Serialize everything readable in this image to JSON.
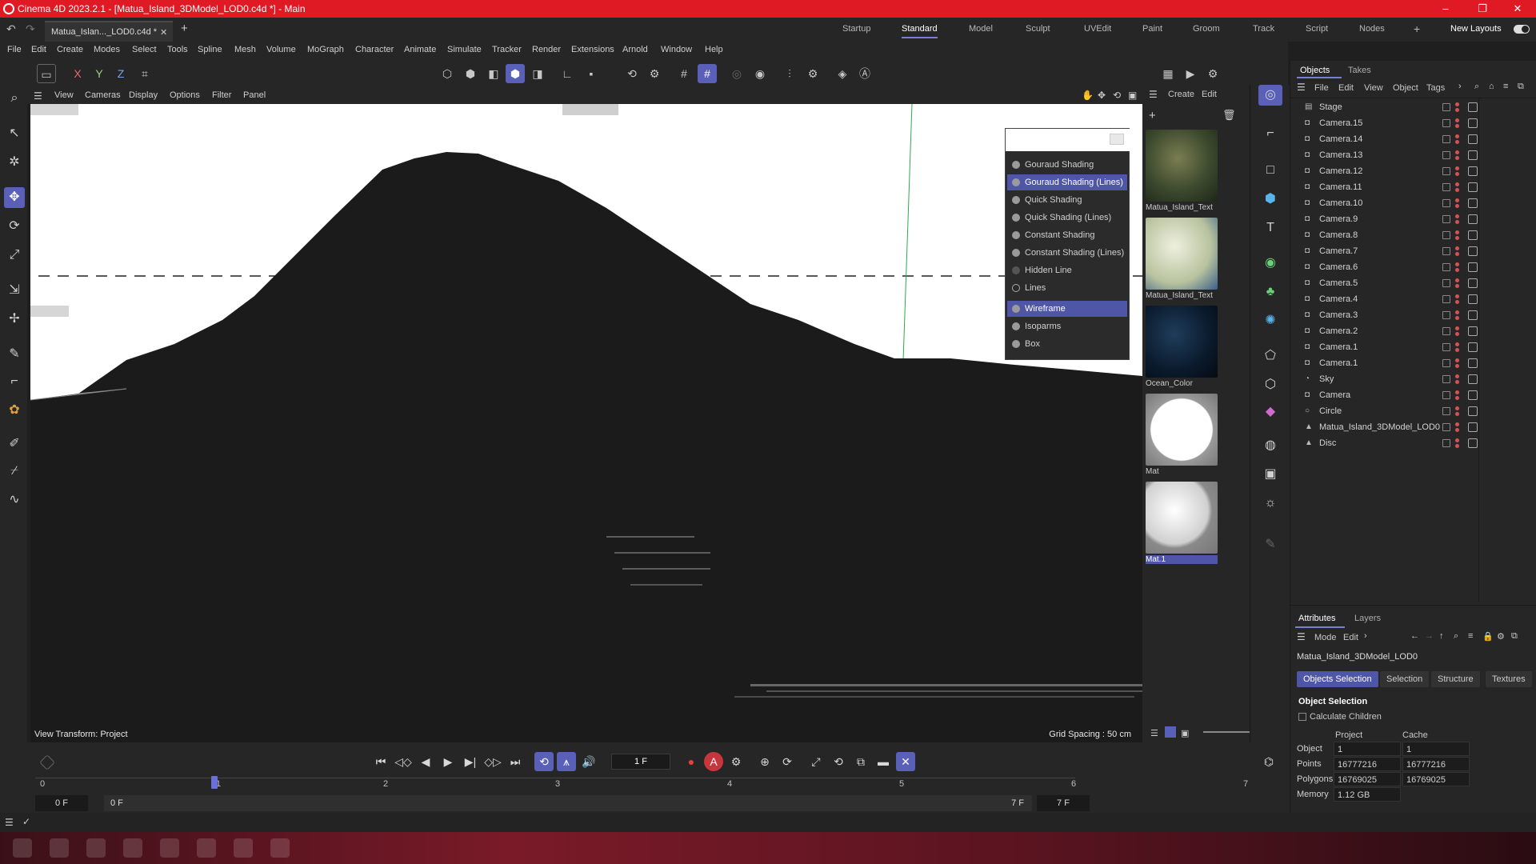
{
  "window": {
    "title": "Cinema 4D 2023.2.1 - [Matua_Island_3DModel_LOD0.c4d *] - Main",
    "minimize": "–",
    "maximize": "❐",
    "close": "✕"
  },
  "doc_tab": {
    "label": "Matua_Islan..._LOD0.c4d *",
    "close": "✕",
    "add": "+"
  },
  "layouts": [
    "Startup",
    "Standard",
    "Model",
    "Sculpt",
    "UVEdit",
    "Paint",
    "Groom",
    "Track",
    "Script",
    "Nodes"
  ],
  "layouts_active": "Standard",
  "layouts_add": "+",
  "new_layouts": "New Layouts",
  "menu": [
    "File",
    "Edit",
    "Create",
    "Modes",
    "Select",
    "Tools",
    "Spline",
    "Mesh",
    "Volume",
    "MoGraph",
    "Character",
    "Animate",
    "Simulate",
    "Tracker",
    "Render",
    "Extensions",
    "Arnold",
    "Window",
    "Help"
  ],
  "axis_buttons": {
    "x": "X",
    "y": "Y",
    "z": "Z"
  },
  "viewport_menu": [
    "View",
    "Cameras",
    "Display",
    "Options",
    "Filter",
    "Panel"
  ],
  "viewport": {
    "view_transform": "View Transform: Project",
    "grid_spacing": "Grid Spacing : 50 cm"
  },
  "display_menu": {
    "items": [
      "Gouraud Shading",
      "Gouraud Shading (Lines)",
      "Quick Shading",
      "Quick Shading (Lines)",
      "Constant Shading",
      "Constant Shading (Lines)",
      "Hidden Line",
      "Lines",
      "Wireframe",
      "Isoparms",
      "Box"
    ],
    "selected": [
      "Gouraud Shading (Lines)",
      "Wireframe"
    ]
  },
  "material_panel": {
    "menu": [
      "Create",
      "Edit"
    ],
    "materials": [
      {
        "name": "Matua_Island_Text",
        "color": "#4a5a3a"
      },
      {
        "name": "Matua_Island_Text",
        "color": "#c9d4b8"
      },
      {
        "name": "Ocean_Color",
        "color": "#0e2236"
      },
      {
        "name": "Mat",
        "color": "#ffffff"
      },
      {
        "name": "Mat.1",
        "color": "#e6e6e6"
      }
    ],
    "selected": "Mat.1"
  },
  "objects_panel": {
    "tabs": [
      "Objects",
      "Takes"
    ],
    "menu": [
      "File",
      "Edit",
      "View",
      "Object",
      "Tags"
    ],
    "items": [
      {
        "name": "Stage",
        "icon": "stage-icon"
      },
      {
        "name": "Camera.15",
        "icon": "camera-icon"
      },
      {
        "name": "Camera.14",
        "icon": "camera-icon"
      },
      {
        "name": "Camera.13",
        "icon": "camera-icon"
      },
      {
        "name": "Camera.12",
        "icon": "camera-icon"
      },
      {
        "name": "Camera.11",
        "icon": "camera-icon"
      },
      {
        "name": "Camera.10",
        "icon": "camera-icon"
      },
      {
        "name": "Camera.9",
        "icon": "camera-icon"
      },
      {
        "name": "Camera.8",
        "icon": "camera-icon"
      },
      {
        "name": "Camera.7",
        "icon": "camera-icon"
      },
      {
        "name": "Camera.6",
        "icon": "camera-icon"
      },
      {
        "name": "Camera.5",
        "icon": "camera-icon"
      },
      {
        "name": "Camera.4",
        "icon": "camera-icon"
      },
      {
        "name": "Camera.3",
        "icon": "camera-icon"
      },
      {
        "name": "Camera.2",
        "icon": "camera-icon"
      },
      {
        "name": "Camera.1",
        "icon": "camera-icon"
      },
      {
        "name": "Camera.1",
        "icon": "camera-icon"
      },
      {
        "name": "Sky",
        "icon": "sky-icon"
      },
      {
        "name": "Camera",
        "icon": "camera-icon"
      },
      {
        "name": "Circle",
        "icon": "circle-icon"
      },
      {
        "name": "Matua_Island_3DModel_LOD0",
        "icon": "polygon-object-icon"
      },
      {
        "name": "Disc",
        "icon": "polygon-object-icon"
      }
    ]
  },
  "attributes_panel": {
    "tabs": [
      "Attributes",
      "Layers"
    ],
    "menu": [
      "Mode",
      "Edit"
    ],
    "object_name": "Matua_Island_3DModel_LOD0",
    "sub_tabs": [
      "Objects Selection",
      "Selection",
      "Structure",
      "Textures"
    ],
    "sub_tab_active": "Objects Selection",
    "section_title": "Object Selection",
    "calc_children": "Calculate Children",
    "columns": [
      "Project",
      "Cache"
    ],
    "rows": [
      {
        "label": "Object",
        "project": "1",
        "cache": "1"
      },
      {
        "label": "Points",
        "project": "16777216",
        "cache": "16777216"
      },
      {
        "label": "Polygons",
        "project": "16769025",
        "cache": "16769025"
      },
      {
        "label": "Memory",
        "project": "1.12 GB",
        "cache": ""
      }
    ]
  },
  "timeline": {
    "current_frame": "1 F",
    "ruler": [
      "0",
      "1",
      "2",
      "3",
      "4",
      "5",
      "6",
      "7"
    ],
    "start": "0 F",
    "preview_start": "0 F",
    "preview_end": "7 F",
    "end": "7 F",
    "playhead_frame": 1
  }
}
